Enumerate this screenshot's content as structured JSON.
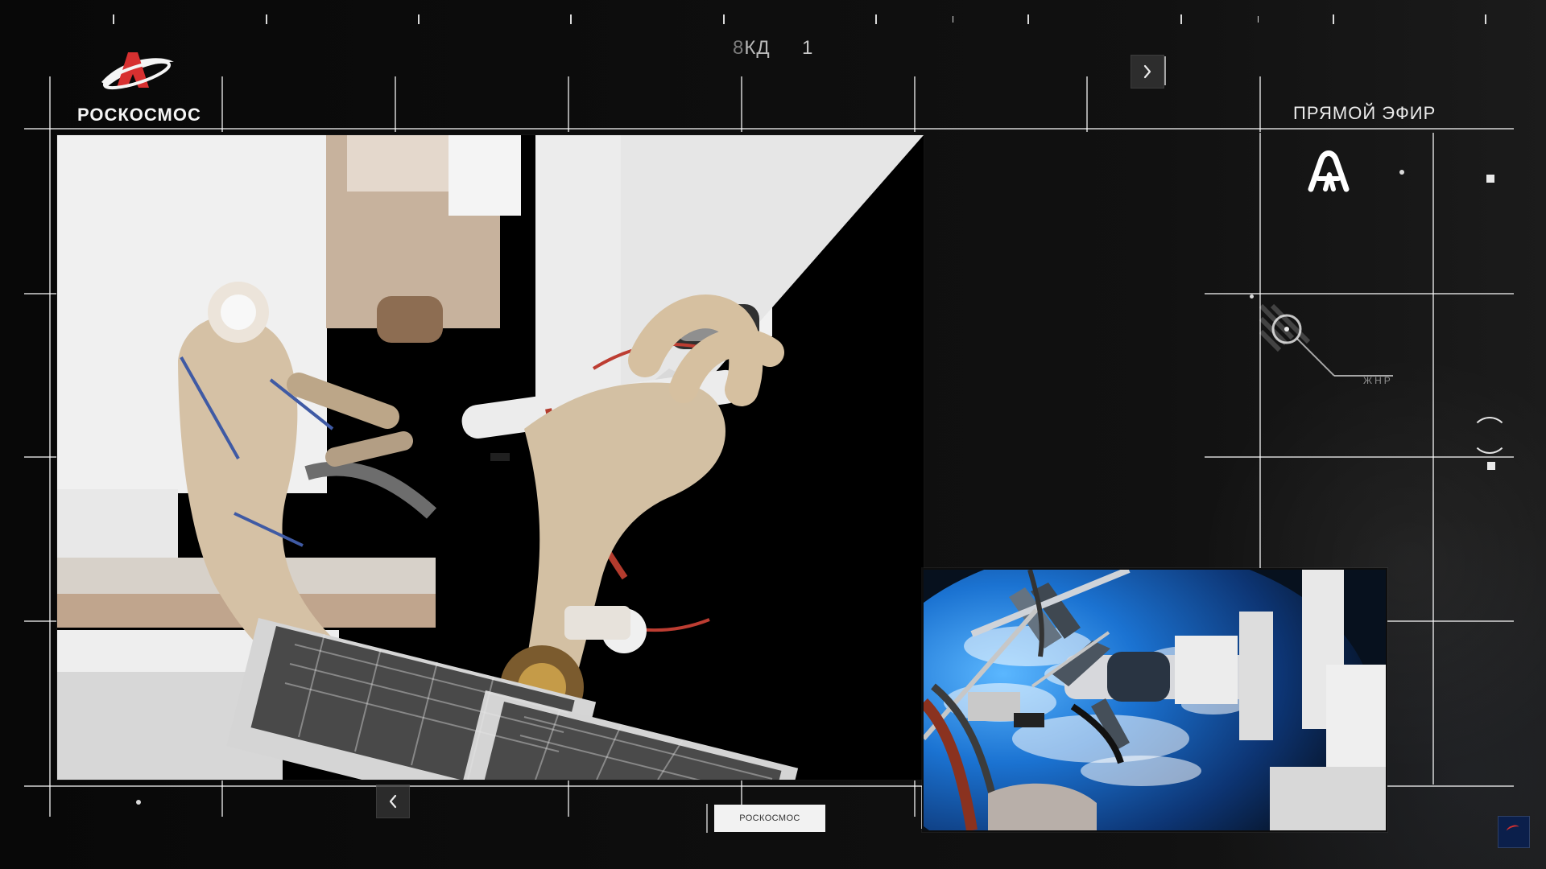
{
  "header": {
    "brand_text": "РОСКОСМОС",
    "top_label_prefix": "8",
    "top_label_main": "КД",
    "top_number": "1",
    "live_label": "ПРЯМОЙ ЭФИР"
  },
  "footer": {
    "brand_box_text": "РОСКОСМОС"
  },
  "hud": {
    "small_code": "ЖНР"
  },
  "icons": {
    "brand_logo": "roscosmos-logo",
    "aa_logo": "aa-logo",
    "right_arrow": "chevron-right-icon",
    "left_arrow": "chevron-left-icon",
    "corner_logo": "roscosmos-mini-logo",
    "target_circle": "target-circle-icon"
  },
  "colors": {
    "background": "#050505",
    "text_primary": "#ececec",
    "text_muted": "#8f8f8f",
    "button_bg": "#373737",
    "brand_red": "#d73030",
    "earth_blue": "#1b73d2"
  }
}
